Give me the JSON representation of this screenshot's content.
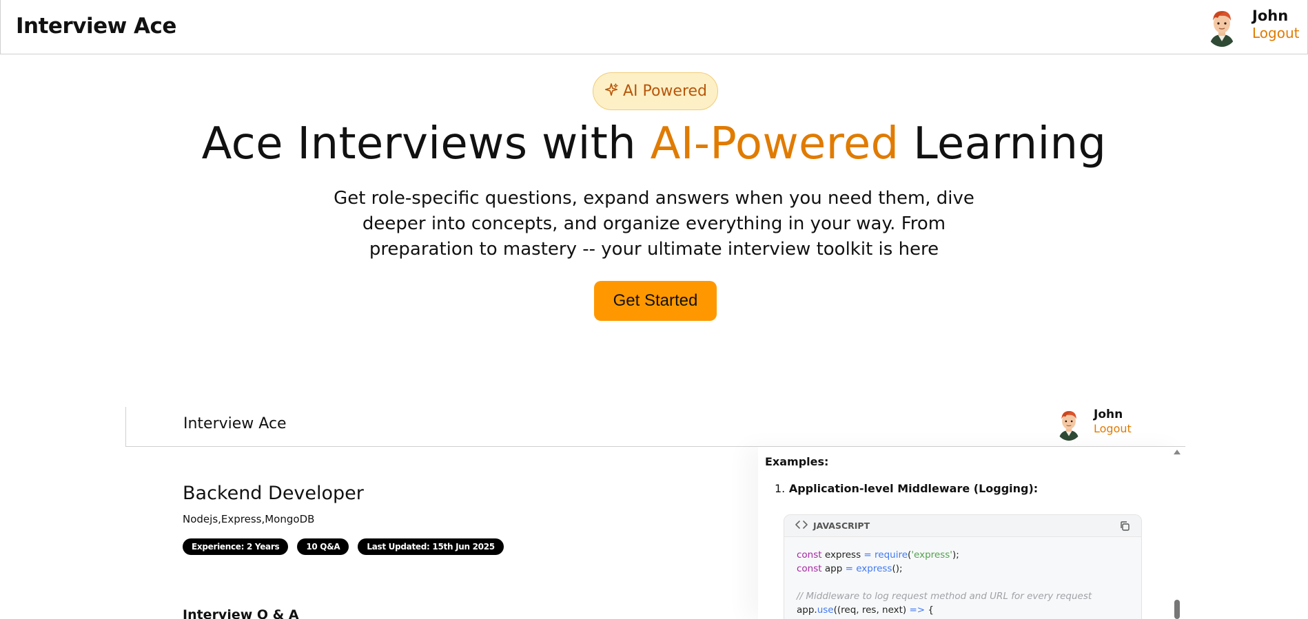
{
  "header": {
    "brand": "Interview Ace",
    "user_name": "John",
    "logout_label": "Logout"
  },
  "hero": {
    "badge_label": "AI Powered",
    "title_before": "Ace Interviews with ",
    "title_accent": "AI-Powered",
    "title_after": " Learning",
    "subtitle": "Get role-specific questions, expand answers when you need them, dive deeper into concepts, and organize everything in your way. From preparation to mastery -- your ultimate interview toolkit is here",
    "cta_label": "Get Started"
  },
  "preview": {
    "header": {
      "brand": "Interview Ace",
      "user_name": "John",
      "logout_label": "Logout"
    },
    "session": {
      "role": "Backend Developer",
      "topics": "Nodejs,Express,MongoDB",
      "pills": [
        "Experience: 2 Years",
        "10 Q&A",
        "Last Updated: 15th Jun 2025"
      ],
      "qa_heading": "Interview Q & A"
    },
    "answer": {
      "examples_label": "Examples:",
      "item_number": "1.",
      "item_title": "Application-level Middleware (Logging):",
      "code_language": "JAVASCRIPT",
      "code_lines": [
        "const express = require('express');",
        "const app = express();",
        "",
        "// Middleware to log request method and URL for every request",
        "app.use((req, res, next) => {"
      ]
    }
  },
  "colors": {
    "accent": "#e07b00",
    "cta": "#ff9800",
    "badge_bg": "#fdf0c6",
    "badge_text": "#b8560a",
    "pill_bg": "#000000"
  },
  "icons": [
    "sparkle-icon",
    "code-icon",
    "copy-icon",
    "avatar"
  ]
}
